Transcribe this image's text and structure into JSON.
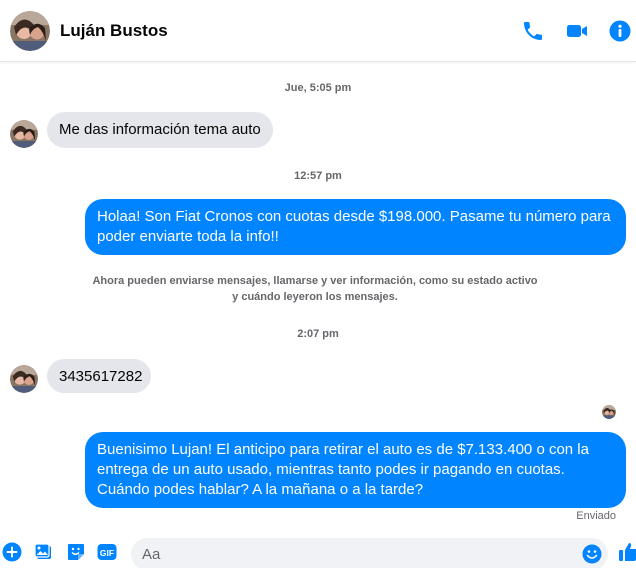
{
  "header": {
    "contact_name": "Luján Bustos",
    "icons": [
      "phone-icon",
      "video-camera-icon",
      "info-icon"
    ]
  },
  "thread": {
    "timestamp_1": "Jue, 5:05 pm",
    "msg_1": "Me das información tema auto",
    "timestamp_2": "12:57 pm",
    "msg_2": "Holaa! Son Fiat Cronos con cuotas desde $198.000. Pasame tu número para poder enviarte toda la info!!",
    "notice": "Ahora pueden enviarse mensajes, llamarse y ver información, como su estado activo y cuándo leyeron los mensajes.",
    "timestamp_3": "2:07 pm",
    "msg_3": "3435617282",
    "msg_4": "Buenisimo Lujan! El anticipo para retirar el auto es de $7.133.400 o con la entrega de un auto usado, mientras tanto podes ir pagando en cuotas. Cuándo podes hablar? A la mañana o a la tarde?",
    "delivery_status": "Enviado"
  },
  "composer": {
    "placeholder": "Aa",
    "icons": [
      "plus-icon",
      "photo-icon",
      "sticker-icon",
      "gif-icon",
      "emoji-icon",
      "thumbs-up-icon"
    ]
  },
  "colors": {
    "accent": "#0084ff",
    "incoming_bubble": "#e4e6eb",
    "meta_text": "#65676b"
  }
}
